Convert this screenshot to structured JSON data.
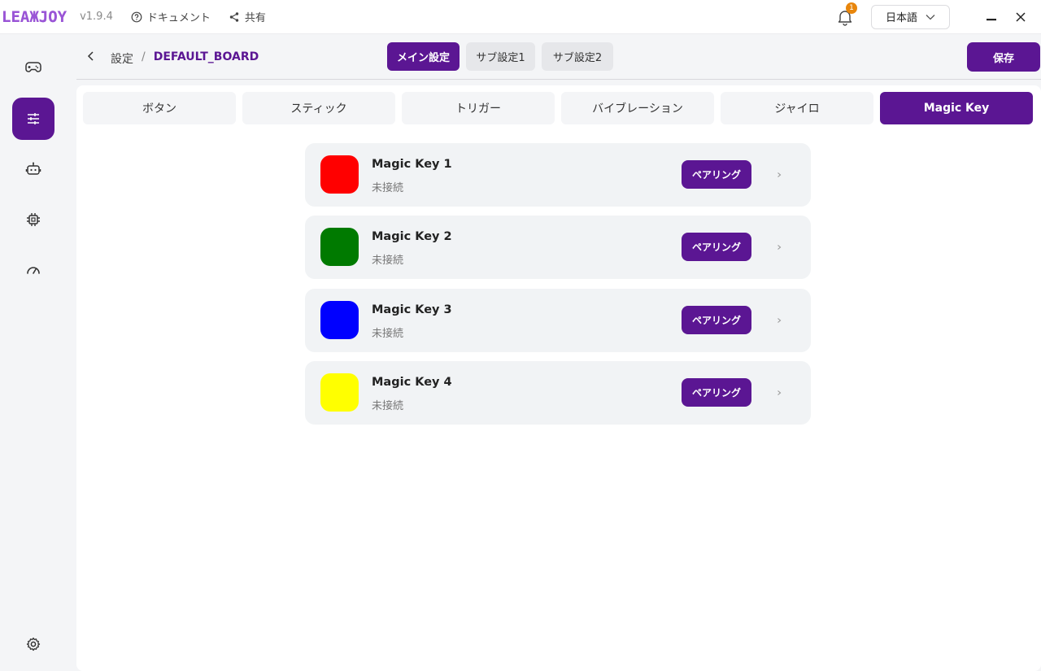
{
  "app": {
    "logo": "LEAЖJOY",
    "version": "v1.9.4",
    "docs_label": "ドキュメント",
    "share_label": "共有",
    "notification_count": "1",
    "language": "日本語"
  },
  "header": {
    "breadcrumb_parent": "設定",
    "breadcrumb_separator": "/",
    "breadcrumb_current": "DEFAULT_BOARD",
    "segments": [
      "メイン設定",
      "サブ設定1",
      "サブ設定2"
    ],
    "save_label": "保存"
  },
  "tabs": [
    "ボタン",
    "スティック",
    "トリガー",
    "バイブレーション",
    "ジャイロ",
    "Magic Key"
  ],
  "active_tab": "Magic Key",
  "magic_keys": [
    {
      "name": "Magic Key 1",
      "status": "未接続",
      "color": "#ff0000",
      "pair_label": "ペアリング"
    },
    {
      "name": "Magic Key 2",
      "status": "未接続",
      "color": "#007a00",
      "pair_label": "ペアリング"
    },
    {
      "name": "Magic Key 3",
      "status": "未接続",
      "color": "#0000ff",
      "pair_label": "ペアリング"
    },
    {
      "name": "Magic Key 4",
      "status": "未接続",
      "color": "#ffff00",
      "pair_label": "ペアリング"
    }
  ],
  "colors": {
    "accent": "#5b1693",
    "badge": "#e8860c"
  }
}
